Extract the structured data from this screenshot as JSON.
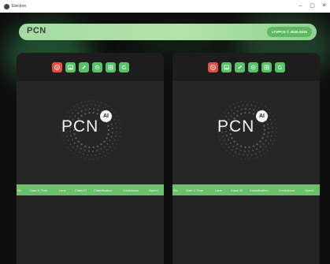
{
  "window": {
    "title": "Electron",
    "minimize": "–",
    "maximize": "▢",
    "close": "✕"
  },
  "header": {
    "brand": "PCN",
    "copyright": "LTVPCN © 2020-2025"
  },
  "panels": [
    {
      "toolbar": [
        {
          "icon": "play-icon",
          "color": "#e64e3f"
        },
        {
          "icon": "image-icon",
          "color": "#57c267"
        },
        {
          "icon": "pencil-icon",
          "color": "#57c267"
        },
        {
          "icon": "gear-icon",
          "color": "#57c267"
        },
        {
          "icon": "grid-icon",
          "color": "#57c267"
        },
        {
          "icon": "refresh-icon",
          "color": "#57c267"
        }
      ],
      "logo": {
        "text": "PCN",
        "badge": "AI"
      },
      "table_headers": [
        "No.",
        "Date & Time",
        "Lane",
        "Class ID",
        "Classification",
        "Confidence",
        "Speed"
      ]
    },
    {
      "toolbar": [
        {
          "icon": "play-icon",
          "color": "#e64e3f"
        },
        {
          "icon": "image-icon",
          "color": "#57c267"
        },
        {
          "icon": "pencil-icon",
          "color": "#57c267"
        },
        {
          "icon": "gear-icon",
          "color": "#57c267"
        },
        {
          "icon": "grid-icon",
          "color": "#57c267"
        },
        {
          "icon": "refresh-icon",
          "color": "#57c267"
        }
      ],
      "logo": {
        "text": "PCN",
        "badge": "AI"
      },
      "table_headers": [
        "No.",
        "Date & Time",
        "Lane",
        "Class ID",
        "Classification",
        "Confidence",
        "Speed"
      ]
    }
  ],
  "colors": {
    "accent_green": "#57c267",
    "accent_red": "#e64e3f",
    "panel_bg": "#262626",
    "app_bg": "#0e0e0e",
    "table_header_bg": "#6dc06b"
  }
}
